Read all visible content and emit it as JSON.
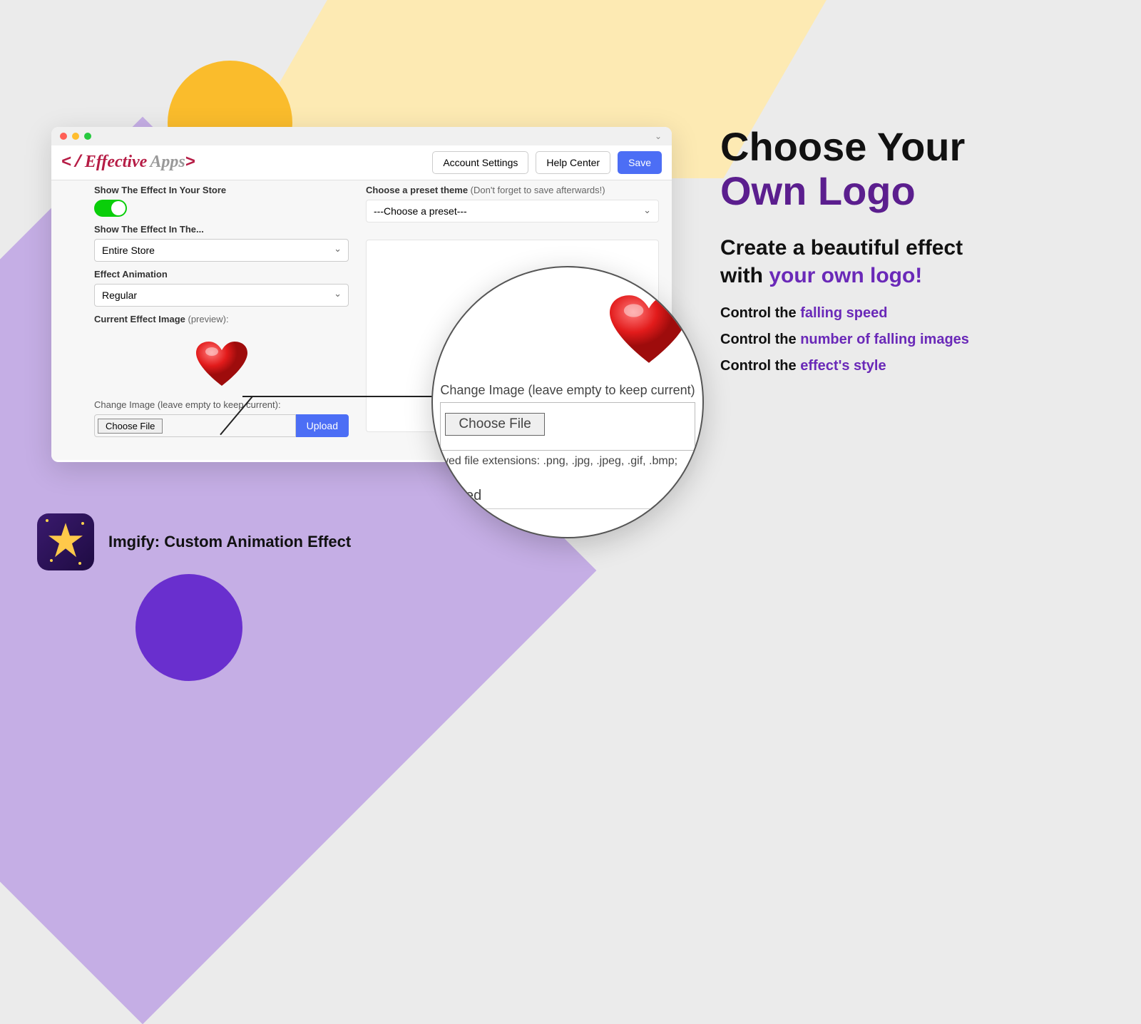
{
  "logo": {
    "word1": "Effective",
    "word2": "Apps"
  },
  "header_buttons": {
    "account": "Account Settings",
    "help": "Help Center",
    "save": "Save"
  },
  "left": {
    "show_effect_label": "Show The Effect In Your Store",
    "show_in_label": "Show The Effect In The...",
    "show_in_value": "Entire Store",
    "animation_label": "Effect Animation",
    "animation_value": "Regular",
    "current_image_label": "Current Effect Image",
    "current_image_hint": "(preview):",
    "change_image_label": "Change Image (leave empty to keep current):",
    "choose_file": "Choose File",
    "upload": "Upload"
  },
  "right": {
    "preset_label": "Choose a preset theme",
    "preset_hint": "(Don't forget to save afterwards!)",
    "preset_value": "---Choose a preset---"
  },
  "zoom": {
    "change_image": "Change Image (leave empty to keep current)",
    "choose_file": "Choose File",
    "allowed": "wed file extensions: .png, .jpg, .jpeg, .gif, .bmp;",
    "speed": "Speed"
  },
  "marketing": {
    "title1": "Choose Your",
    "title2": "Own Logo",
    "sub1": "Create a beautiful effect",
    "sub2_pre": "with ",
    "sub2_accent": "your own logo!",
    "bullets": [
      {
        "pre": "Control the ",
        "accent": "falling speed"
      },
      {
        "pre": "Control the ",
        "accent": "number of falling images"
      },
      {
        "pre": "Control the ",
        "accent": "effect's style"
      }
    ]
  },
  "app_name": "Imgify: Custom Animation Effect"
}
